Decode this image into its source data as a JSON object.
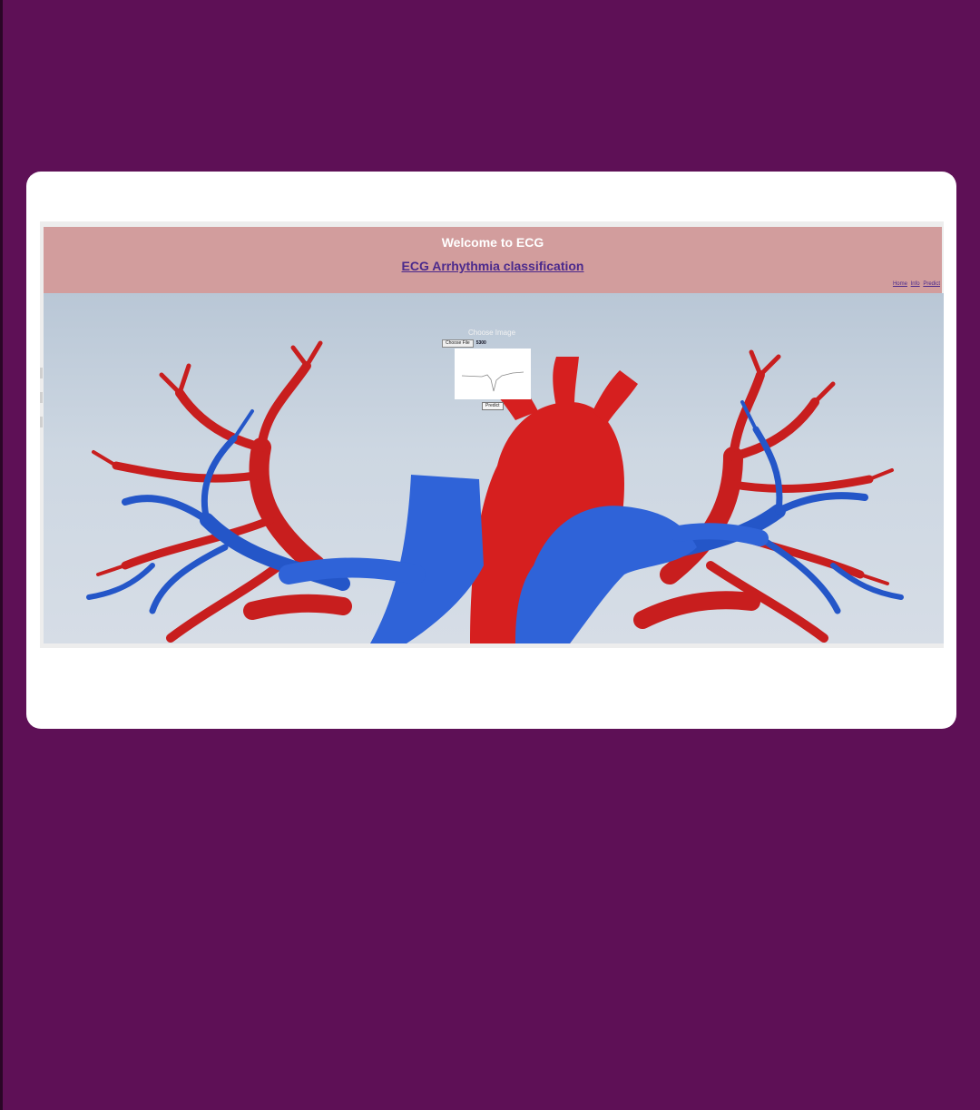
{
  "header": {
    "welcome": "Welcome to ECG",
    "title": "ECG Arrhythmia classification"
  },
  "nav": {
    "items": [
      "Home",
      "Info",
      "Predict"
    ]
  },
  "form": {
    "choose_label": "Choose Image",
    "file_button": "Choose File",
    "file_name": "5300",
    "predict_button": "Predict"
  },
  "colors": {
    "background": "#5e1056",
    "header": "#d29d9d",
    "link": "#4b2a8c",
    "artery": "#d61f1f",
    "vein": "#2a5fd6"
  }
}
